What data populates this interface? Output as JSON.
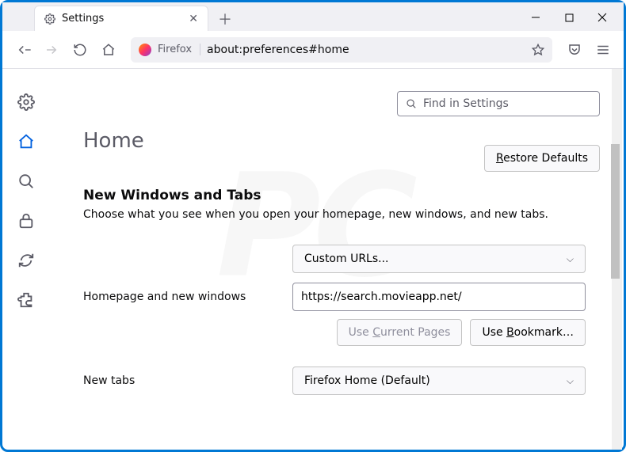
{
  "window": {
    "tab_label": "Settings",
    "firefox_label": "Firefox",
    "url": "about:preferences#home"
  },
  "search": {
    "placeholder": "Find in Settings"
  },
  "page": {
    "title": "Home",
    "restore_label": "Restore Defaults",
    "restore_accesskey": "R"
  },
  "section": {
    "title": "New Windows and Tabs",
    "desc": "Choose what you see when you open your homepage, new windows, and new tabs."
  },
  "homepage": {
    "label": "Homepage and new windows",
    "select_value": "Custom URLs...",
    "input_value": "https://search.movieapp.net/",
    "use_current": "Use Current Pages",
    "use_current_key": "C",
    "use_bookmark": "Use Bookmark…",
    "use_bookmark_key": "B"
  },
  "newtabs": {
    "label": "New tabs",
    "select_value": "Firefox Home (Default)"
  }
}
